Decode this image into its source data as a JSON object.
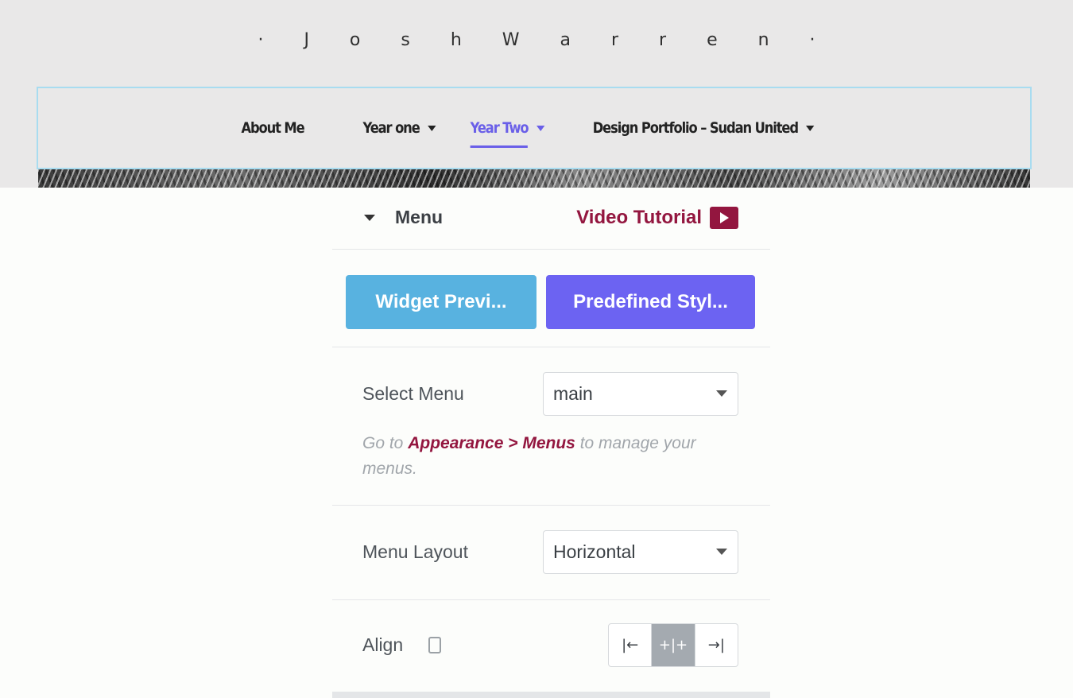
{
  "site": {
    "title": "· J o s h   W a r r e n ·"
  },
  "nav": {
    "items": [
      {
        "label": "About Me",
        "has_dropdown": false,
        "active": false
      },
      {
        "label": "Year one",
        "has_dropdown": true,
        "active": false
      },
      {
        "label": "Year Two",
        "has_dropdown": true,
        "active": true
      },
      {
        "label": "Design Portfolio – Sudan United",
        "has_dropdown": true,
        "active": false
      }
    ],
    "active_color": "#6a5fe8"
  },
  "panel": {
    "section_title": "Menu",
    "video_tutorial": "Video Tutorial",
    "buttons": {
      "widget_preview": "Widget Previ...",
      "predefined_styles": "Predefined Styl..."
    },
    "select_menu": {
      "label": "Select Menu",
      "value": "main"
    },
    "help": {
      "prefix": "Go to ",
      "link": "Appearance > Menus",
      "suffix": " to manage your menus."
    },
    "menu_layout": {
      "label": "Menu Layout",
      "value": "Horizontal"
    },
    "align": {
      "label": "Align",
      "options": [
        "|←",
        "+|+",
        "→|"
      ],
      "selected": "center"
    }
  },
  "colors": {
    "accent": "#93163f",
    "preview_button": "#58b2e0",
    "predefined_button": "#6c63f2"
  }
}
